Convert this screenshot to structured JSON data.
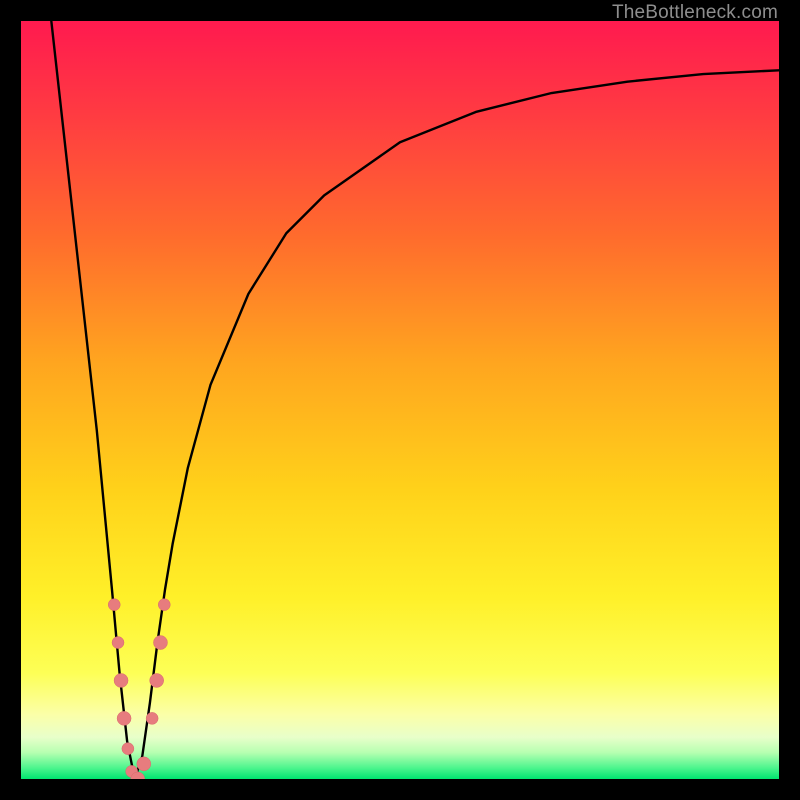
{
  "watermark": {
    "text": "TheBottleneck.com"
  },
  "colors": {
    "black": "#000000",
    "curve": "#000000",
    "dot_fill": "#e77c7e",
    "dot_stroke": "#d86a6c",
    "grad_top": "#ff1a4f",
    "grad_mid1": "#ff6a2d",
    "grad_mid2": "#ffb21f",
    "grad_mid3": "#fff029",
    "grad_light": "#fbffa8",
    "grad_pale": "#d9ffb0",
    "grad_green": "#00e56f"
  },
  "chart_data": {
    "type": "line",
    "title": "",
    "xlabel": "",
    "ylabel": "",
    "xlim": [
      0,
      100
    ],
    "ylim": [
      0,
      100
    ],
    "grid": false,
    "legend": false,
    "description": "Bottleneck-style V curve. Y-axis represents bottleneck percentage (0 = no bottleneck green, 100 = full bottleneck red). X-axis is component pairing ratio. Minimum near x≈15.",
    "series": [
      {
        "name": "bottleneck_curve",
        "x": [
          4,
          6,
          8,
          10,
          12,
          13,
          14,
          15,
          16,
          17,
          18,
          19,
          20,
          22,
          25,
          30,
          35,
          40,
          50,
          60,
          70,
          80,
          90,
          100
        ],
        "y": [
          100,
          82,
          64,
          46,
          25,
          14,
          5,
          0,
          3,
          10,
          18,
          25,
          31,
          41,
          52,
          64,
          72,
          77,
          84,
          88,
          90.5,
          92,
          93,
          93.5
        ]
      }
    ],
    "markers": [
      {
        "x": 12.3,
        "y": 23,
        "r": 6
      },
      {
        "x": 12.8,
        "y": 18,
        "r": 6
      },
      {
        "x": 13.2,
        "y": 13,
        "r": 7
      },
      {
        "x": 13.6,
        "y": 8,
        "r": 7
      },
      {
        "x": 14.1,
        "y": 4,
        "r": 6
      },
      {
        "x": 14.6,
        "y": 1,
        "r": 6
      },
      {
        "x": 15.4,
        "y": 0,
        "r": 7
      },
      {
        "x": 16.2,
        "y": 2,
        "r": 7
      },
      {
        "x": 17.3,
        "y": 8,
        "r": 6
      },
      {
        "x": 17.9,
        "y": 13,
        "r": 7
      },
      {
        "x": 18.4,
        "y": 18,
        "r": 7
      },
      {
        "x": 18.9,
        "y": 23,
        "r": 6
      }
    ]
  }
}
